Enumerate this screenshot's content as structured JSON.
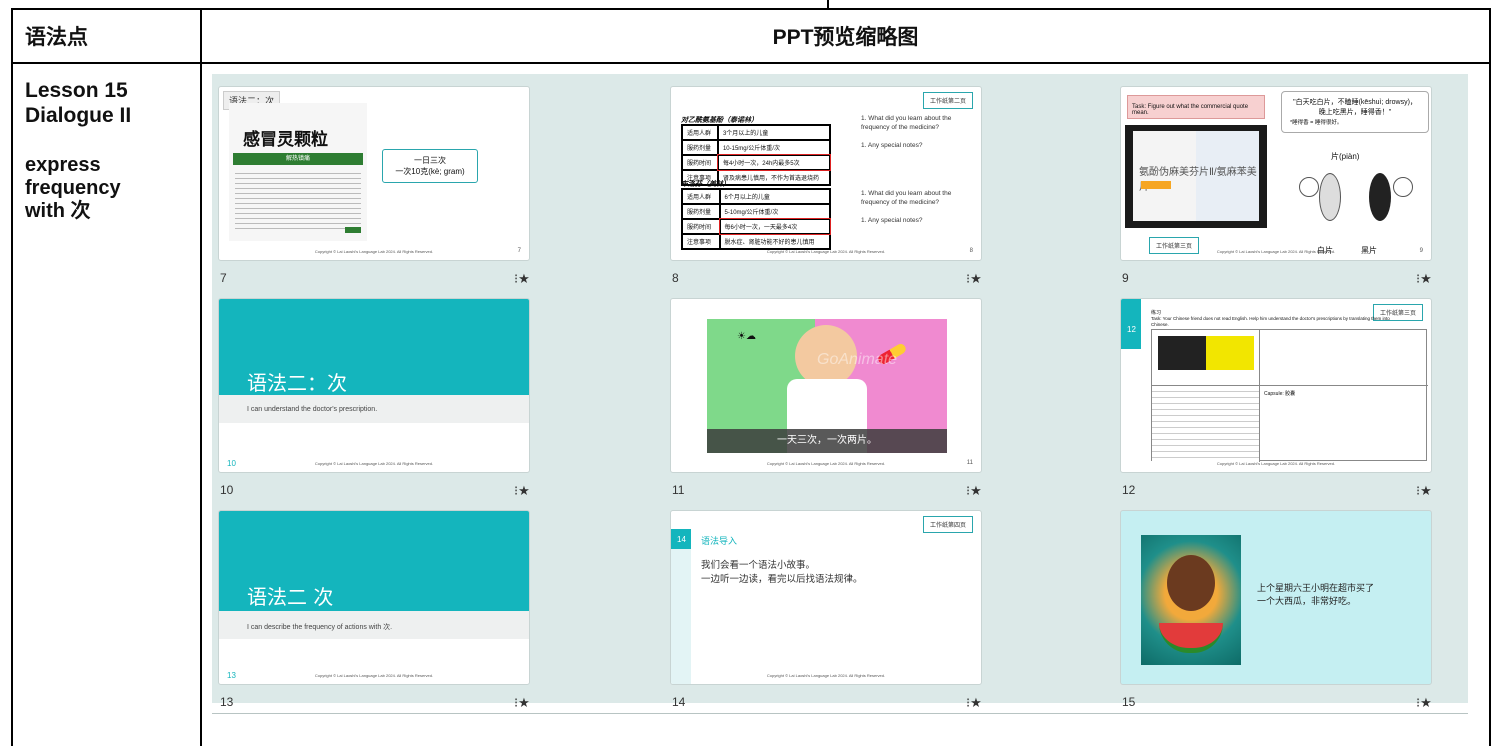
{
  "table": {
    "header_left": "语法点",
    "header_right": "PPT预览缩略图",
    "lesson_line1": "Lesson 15",
    "lesson_line2": "Dialogue II",
    "grammar_line1": "express",
    "grammar_line2": "frequency",
    "grammar_line3": "with 次"
  },
  "slides": [
    {
      "number": "7",
      "tag": "语法二：次",
      "brand": "999",
      "product": "感冒灵颗粒",
      "green_bar": "解热镇痛",
      "bubble_line1": "一日三次",
      "bubble_line2": "一次10克(kè; gram)",
      "page_no": "7"
    },
    {
      "number": "8",
      "worksheet": "工作纸第二页",
      "drug1": "对乙酰氨基酚（泰诺林）",
      "drug1_rows": [
        [
          "适用人群",
          "3个月以上的儿童"
        ],
        [
          "服药剂量",
          "10-15mg/公斤体重/次"
        ],
        [
          "服药时间",
          "每4小时一次，24h内最多5次"
        ],
        [
          "注意事项",
          "肾及病患儿慎用，不作为首选退烧药"
        ]
      ],
      "drug2": "布洛芬（美林）",
      "drug2_rows": [
        [
          "适用人群",
          "6个月以上的儿童"
        ],
        [
          "服药剂量",
          "5-10mg/公斤体重/次"
        ],
        [
          "服药时间",
          "每6小时一次，一天最多4次"
        ],
        [
          "注意事项",
          "脱水症、肾脏功能不好的患儿慎用"
        ]
      ],
      "q1": "1.  What did you learn about the frequency of the medicine?",
      "q2": "1.  Any special notes?",
      "q3": "1.  What did you learn about the frequency of the medicine?",
      "q4": "1.  Any special notes?",
      "page_no": "8"
    },
    {
      "number": "9",
      "task": "Task: Figure out what the commercial quote mean.",
      "quote_line1": "\"白天吃白片，不瞌睡(kēshuì; drowsy)，",
      "quote_line2": "晚上吃黑片，睡得香！\"",
      "quote_note": "*睡得香 = 睡得很好。",
      "pian": "片(piàn)",
      "box_text": "氨酚伪麻美芬片Ⅱ/氨麻苯美片",
      "worksheet": "工作纸第三页",
      "white": "白片",
      "black": "黑片",
      "page_no": "9"
    },
    {
      "number": "10",
      "title": "语法二：次",
      "subtitle": "I can understand the doctor's prescription.",
      "corner_no": "10"
    },
    {
      "number": "11",
      "caption": "一天三次，一次两片。",
      "watermark": "GoAnimate",
      "page_no": "11"
    },
    {
      "number": "12",
      "worksheet": "工作纸第三页",
      "heading": "练习",
      "task": "Task: Your Chinese friend does not read English. Help him understand the doctor's prescriptions by translating them into Chinese.",
      "capsule": "Capsule: 胶囊",
      "corner_no": "12"
    },
    {
      "number": "13",
      "title": "语法二 次",
      "subtitle": "I can describe the frequency of actions with 次.",
      "corner_no": "13"
    },
    {
      "number": "14",
      "worksheet": "工作纸第四页",
      "heading": "语法导入",
      "line1": "我们会看一个语法小故事。",
      "line2": "一边听一边读，看完以后找语法规律。",
      "corner_no": "14"
    },
    {
      "number": "15",
      "line1": "上个星期六王小明在超市买了",
      "line2": "一个大西瓜，非常好吃。"
    }
  ],
  "copyright": "Copyright © Lai Laoshi's Language Lab 2024. All Rights Reserved.",
  "star_icon": "star-icon",
  "colors": {
    "teal": "#14b5bd",
    "gallery_bg": "#dce9e8",
    "green": "#2e7d32",
    "red": "#d22222"
  }
}
